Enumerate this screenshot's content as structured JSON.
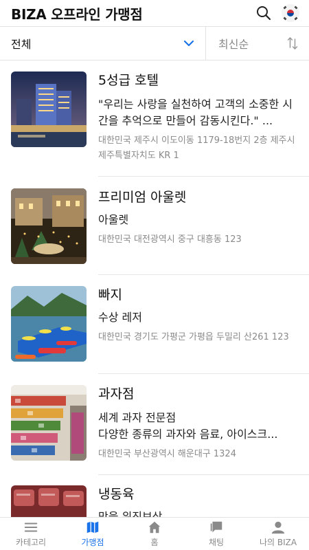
{
  "header": {
    "title": "BIZA 오프라인 가맹점"
  },
  "filter": {
    "category": "전체",
    "sort": "최신순"
  },
  "items": [
    {
      "name": "5성급 호텔",
      "desc": "\"우리는 사랑을 실천하여 고객의 소중한 시간을 추억으로 만들어 감동시킨다.\" ...",
      "addr": "대한민국 제주시 이도이동 1179-18번지 2층 제주시 제주특별자치도 KR 1"
    },
    {
      "name": "프리미엄 아울렛",
      "desc": "아울렛",
      "addr": "대한민국 대전광역시 중구 대흥동 123"
    },
    {
      "name": "빠지",
      "desc": "수상 레저",
      "addr": "대한민국 경기도 가평군 가평읍 두밀리 산261 123"
    },
    {
      "name": "과자점",
      "desc": "세계 과자 전문점\n다양한 종류의 과자와 음료, 아이스크...",
      "addr": "대한민국 부산광역시 해운대구 1324"
    },
    {
      "name": "냉동육",
      "desc": "맛을 위진보상"
    }
  ],
  "tabs": [
    {
      "label": "카테고리"
    },
    {
      "label": "가맹점"
    },
    {
      "label": "홈"
    },
    {
      "label": "채팅"
    },
    {
      "label": "나의 BIZA"
    }
  ],
  "colors": {
    "accent": "#1a73e8",
    "muted": "#8a8a8a",
    "divider": "#e6e6e6",
    "flag_red": "#cd2e3a",
    "flag_blue": "#0047a0"
  },
  "icons": [
    "search-icon",
    "korea-flag-icon",
    "chevron-down-icon",
    "sort-arrows-icon",
    "menu-icon",
    "map-icon",
    "home-icon",
    "chat-icon",
    "person-icon"
  ]
}
